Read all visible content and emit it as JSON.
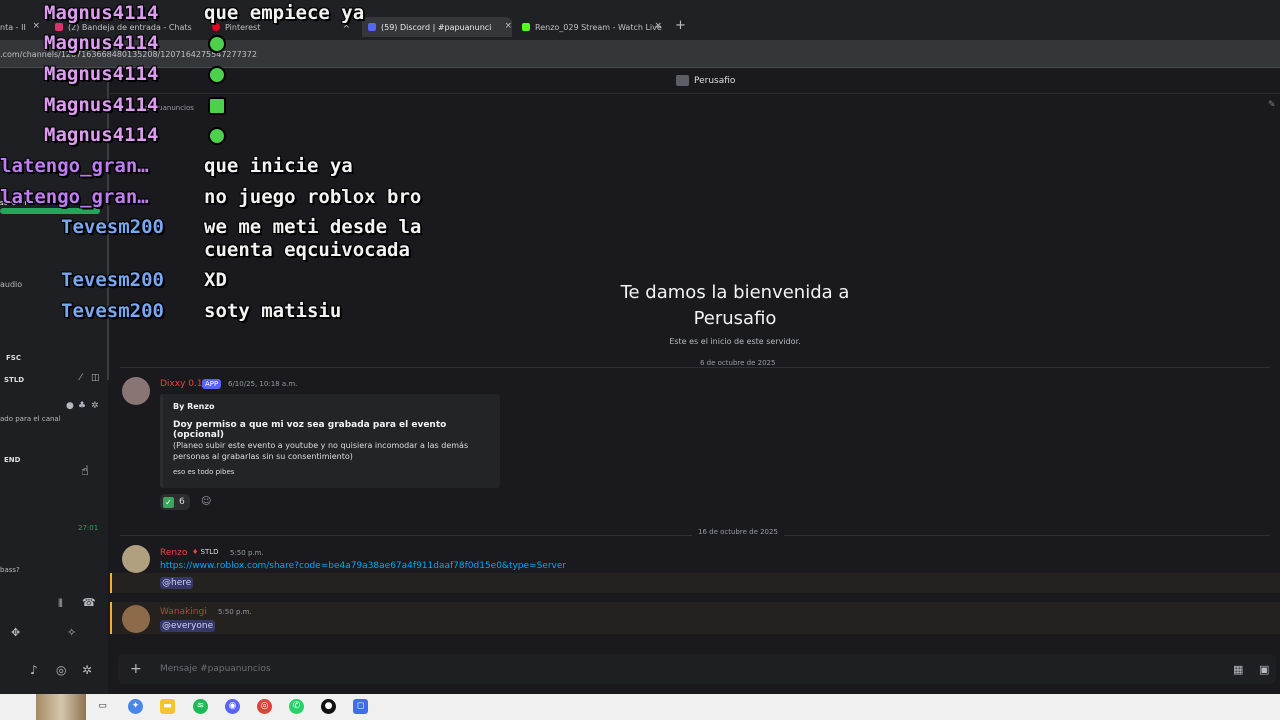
{
  "browser": {
    "tabs": [
      {
        "label": "nta - II"
      },
      {
        "label": "(2) Bandeja de entrada - Chats"
      },
      {
        "label": "Pinterest"
      },
      {
        "label": "(59) Discord | #papuanunci"
      },
      {
        "label": "Renzo_029 Stream - Watch Live"
      }
    ],
    "url": ".com/channels/1207163668480135208/1207164275547277372"
  },
  "sidebar": {
    "listen_label": "scuchar",
    "audio_label": "audio",
    "fsc_label": "FSC",
    "stld_label": "STLD",
    "channel_note": "ado para el canal",
    "end_label": "END",
    "timer": "27:01",
    "bass_label": "bass?"
  },
  "server": {
    "name": "Perusafio",
    "channel_partial": "papuanuncios"
  },
  "welcome": {
    "title": "Te damos la bienvenida a Perusafio",
    "subtitle": "Este es el inicio de este servidor."
  },
  "dates": {
    "first": "6 de octubre de 2025",
    "second": "16 de octubre de 2025"
  },
  "messages": [
    {
      "author": "Dixxy 0.1",
      "badge": "APP",
      "time": "6/10/25, 10:18 a.m.",
      "embed": {
        "author": "By Renzo",
        "title": "Doy permiso a que mi voz sea grabada para el evento (opcional)",
        "description": "(Planeo subir este evento a youtube y no quisiera incomodar a las demás personas al grabarlas sin su consentimiento)",
        "footer": "eso es todo pibes"
      },
      "reaction_count": "6"
    },
    {
      "author": "Renzo",
      "tag": "STLD",
      "time": "5:50 p.m.",
      "link": "https://www.roblox.com/share?code=be4a79a38ae67a4f911daaf78f0d15e0&type=Server",
      "mention": "@here"
    },
    {
      "author": "Wanakingi",
      "time": "5:50 p.m.",
      "mention": "@everyone"
    }
  ],
  "composer": {
    "placeholder": "Mensaje #papuanuncios"
  },
  "stream_chat": [
    {
      "user": "Magnus4114",
      "text": "que empiece ya",
      "color": "#dd9cf0"
    },
    {
      "user": "Magnus4114",
      "text": "",
      "color": "#dd9cf0",
      "emote": "green-emote"
    },
    {
      "user": "Magnus4114",
      "text": "",
      "color": "#dd9cf0",
      "emote": "green-emote"
    },
    {
      "user": "Magnus4114",
      "text": "",
      "color": "#dd9cf0",
      "emote": "green-emote"
    },
    {
      "user": "Magnus4114",
      "text": "",
      "color": "#dd9cf0",
      "emote": "green-emote"
    },
    {
      "user": "latengo_gran…",
      "text": "que inicie ya",
      "color": "#c07cf5"
    },
    {
      "user": "latengo_gran…",
      "text": "no juego roblox bro",
      "color": "#c07cf5"
    },
    {
      "user": "Tevesm200",
      "text": "we me meti desde la",
      "text2": "cuenta eqcuivocada",
      "color": "#79a8f2"
    },
    {
      "user": "Tevesm200",
      "text": "XD",
      "color": "#79a8f2"
    },
    {
      "user": "Tevesm200",
      "text": "soty matisiu",
      "color": "#79a8f2"
    }
  ],
  "colors": {
    "discord_bg": "#1a1a1e",
    "sidebar_bg": "#1e1f22",
    "link": "#00a8fc",
    "mention_bg": "#5865f2",
    "username_red": "#f23f43"
  }
}
